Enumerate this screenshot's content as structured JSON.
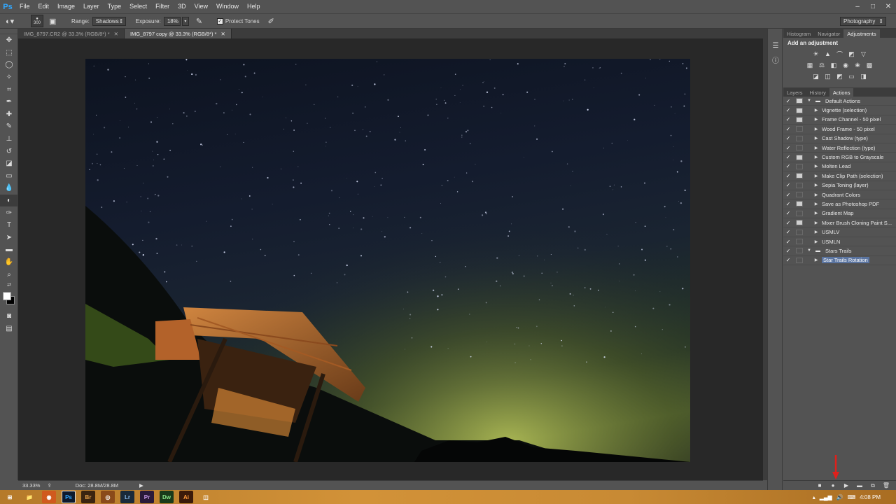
{
  "app": {
    "logo": "Ps"
  },
  "menu": [
    "File",
    "Edit",
    "Image",
    "Layer",
    "Type",
    "Select",
    "Filter",
    "3D",
    "View",
    "Window",
    "Help"
  ],
  "window_controls": [
    "–",
    "□",
    "✕"
  ],
  "options_bar": {
    "brush_size": "300",
    "range_label": "Range:",
    "range_value": "Shadows",
    "exposure_label": "Exposure:",
    "exposure_value": "18%",
    "protect_tones_label": "Protect Tones",
    "workspace": "Photography"
  },
  "doc_tabs": [
    {
      "title": "IMG_8797.CR2 @ 33.3% (RGB/8*) *",
      "close": "✕"
    },
    {
      "title": "IMG_8797 copy @ 33.3% (RGB/8*) *",
      "close": "✕"
    }
  ],
  "status": {
    "zoom": "33.33%",
    "doc": "Doc: 28.8M/28.8M"
  },
  "panels": {
    "top_tabs": [
      "Histogram",
      "Navigator",
      "Adjustments"
    ],
    "adjustments_title": "Add an adjustment",
    "bottom_tabs": [
      "Layers",
      "History",
      "Actions"
    ],
    "actions": [
      {
        "label": "Default Actions",
        "level": 0,
        "folder": true,
        "expanded": true,
        "toggle": true
      },
      {
        "label": "Vignette (selection)",
        "level": 1,
        "toggle": true
      },
      {
        "label": "Frame Channel - 50 pixel",
        "level": 1,
        "toggle": true
      },
      {
        "label": "Wood Frame - 50 pixel",
        "level": 1,
        "toggle": false
      },
      {
        "label": "Cast Shadow (type)",
        "level": 1,
        "toggle": false
      },
      {
        "label": "Water Reflection (type)",
        "level": 1,
        "toggle": false
      },
      {
        "label": "Custom RGB to Grayscale",
        "level": 1,
        "toggle": true
      },
      {
        "label": "Molten Lead",
        "level": 1,
        "toggle": false
      },
      {
        "label": "Make Clip Path (selection)",
        "level": 1,
        "toggle": true
      },
      {
        "label": "Sepia Toning (layer)",
        "level": 1,
        "toggle": false
      },
      {
        "label": "Quadrant Colors",
        "level": 1,
        "toggle": false
      },
      {
        "label": "Save as Photoshop PDF",
        "level": 1,
        "toggle": true
      },
      {
        "label": "Gradient Map",
        "level": 1,
        "toggle": false
      },
      {
        "label": "Mixer Brush Cloning Paint S...",
        "level": 1,
        "toggle": true
      },
      {
        "label": "USMLV",
        "level": 1,
        "toggle": false
      },
      {
        "label": "USMLN",
        "level": 1,
        "toggle": false
      },
      {
        "label": "Stars Trails",
        "level": 0,
        "folder": true,
        "expanded": true,
        "toggle": false
      },
      {
        "label": "Star Trails Rotation",
        "level": 1,
        "toggle": false,
        "selected": true
      }
    ]
  },
  "taskbar": {
    "apps": [
      "⊞",
      "📁",
      "◉",
      "Ps",
      "Br",
      "◎",
      "Lr",
      "Pr",
      "Dw",
      "Ai",
      "◫"
    ],
    "clock": "4:08 PM"
  },
  "colors": {
    "accent": "#31a8ff",
    "arrow": "#e0201b",
    "selection": "#5a74a0"
  }
}
